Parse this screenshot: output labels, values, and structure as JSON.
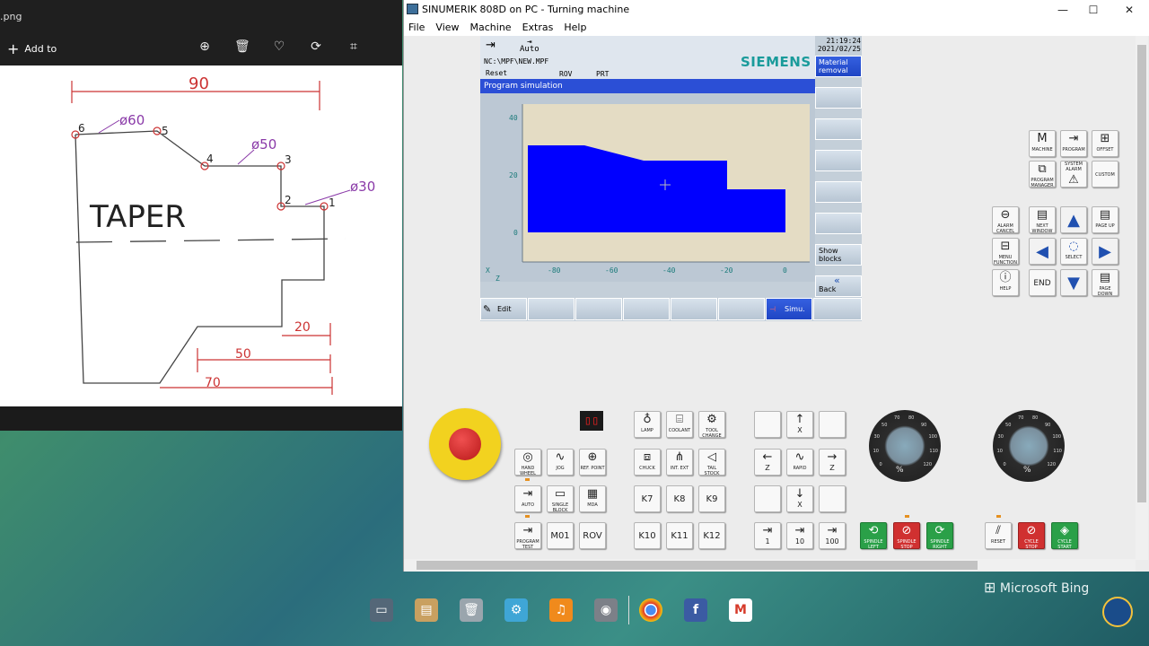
{
  "photos": {
    "filename": ".png",
    "add_to_label": "Add to",
    "sketch": {
      "dim_90": "90",
      "dia_60": "ø60",
      "dia_50": "ø50",
      "dia_30": "ø30",
      "label_taper": "TAPER",
      "dim_20": "20",
      "dim_50": "50",
      "dim_70": "70",
      "pt_1": "1",
      "pt_2": "2",
      "pt_3": "3",
      "pt_4": "4",
      "pt_5": "5",
      "pt_6": "6"
    }
  },
  "sinumerik": {
    "window_title": "SINUMERIK 808D on PC - Turning machine",
    "menu": [
      "File",
      "View",
      "Machine",
      "Extras",
      "Help"
    ],
    "screen": {
      "mode": "Auto",
      "time": "21:19:24",
      "date": "2021/02/25",
      "path": "NC:\\MPF\\NEW.MPF",
      "reset": "Reset",
      "rov": "ROV",
      "prt": "PRT",
      "brand": "SIEMENS",
      "title_bar": "Program simulation",
      "vsoftkeys": [
        "Material removal",
        "",
        "",
        "",
        "",
        "",
        "Show blocks",
        "Back"
      ],
      "hsoftkeys": [
        "Edit",
        "",
        "",
        "",
        "",
        "",
        "Simu.",
        ""
      ],
      "plot": {
        "y_ticks": [
          "40",
          "20",
          "0"
        ],
        "x_ticks": [
          "-80",
          "-60",
          "-40",
          "-20",
          "0"
        ],
        "axis_x": "X",
        "axis_z": "Z"
      }
    },
    "panel": {
      "top_keys": [
        "MACHINE",
        "PROGRAM",
        "OFFSET",
        "PROGRAM MANAGER",
        "SYSTEM ALARM",
        "CUSTOM"
      ],
      "nav_keys": [
        "ALARM CANCEL",
        "NEXT WINDOW",
        "PAGE UP",
        "MENU FUNCTION",
        "SELECT",
        "HELP",
        "END",
        "PAGE DOWN"
      ],
      "mode_keys": [
        "HAND WHEEL",
        "JOG",
        "REF. POINT",
        "AUTO",
        "SINGLE BLOCK",
        "MDA",
        "PROGRAM TEST",
        "M01",
        "ROV"
      ],
      "k_keys": [
        "LAMP",
        "COOLANT",
        "TOOL CHANGE",
        "CHUCK",
        "INT. EXT",
        "TAIL STOCK",
        "K7",
        "K8",
        "K9",
        "K10",
        "K11",
        "K12"
      ],
      "axis_keys": [
        "X",
        "Z",
        "RAPID",
        "Z",
        "X",
        "1",
        "10",
        "100"
      ],
      "spindle_keys": [
        "SPINDLE LEFT",
        "SPINDLE STOP",
        "SPINDLE RIGHT"
      ],
      "cycle_keys": [
        "RESET",
        "CYCLE STOP",
        "CYCLE START"
      ],
      "dial1_ticks": [
        "0",
        "10",
        "30",
        "50",
        "70",
        "80",
        "90",
        "100",
        "110",
        "120"
      ],
      "dial1_label": "%",
      "dial2_ticks": [
        "0",
        "10",
        "30",
        "50",
        "70",
        "80",
        "90",
        "100",
        "110",
        "120"
      ],
      "dial2_label": "%"
    }
  },
  "taskbar": {
    "bing_label": "Microsoft Bing"
  }
}
